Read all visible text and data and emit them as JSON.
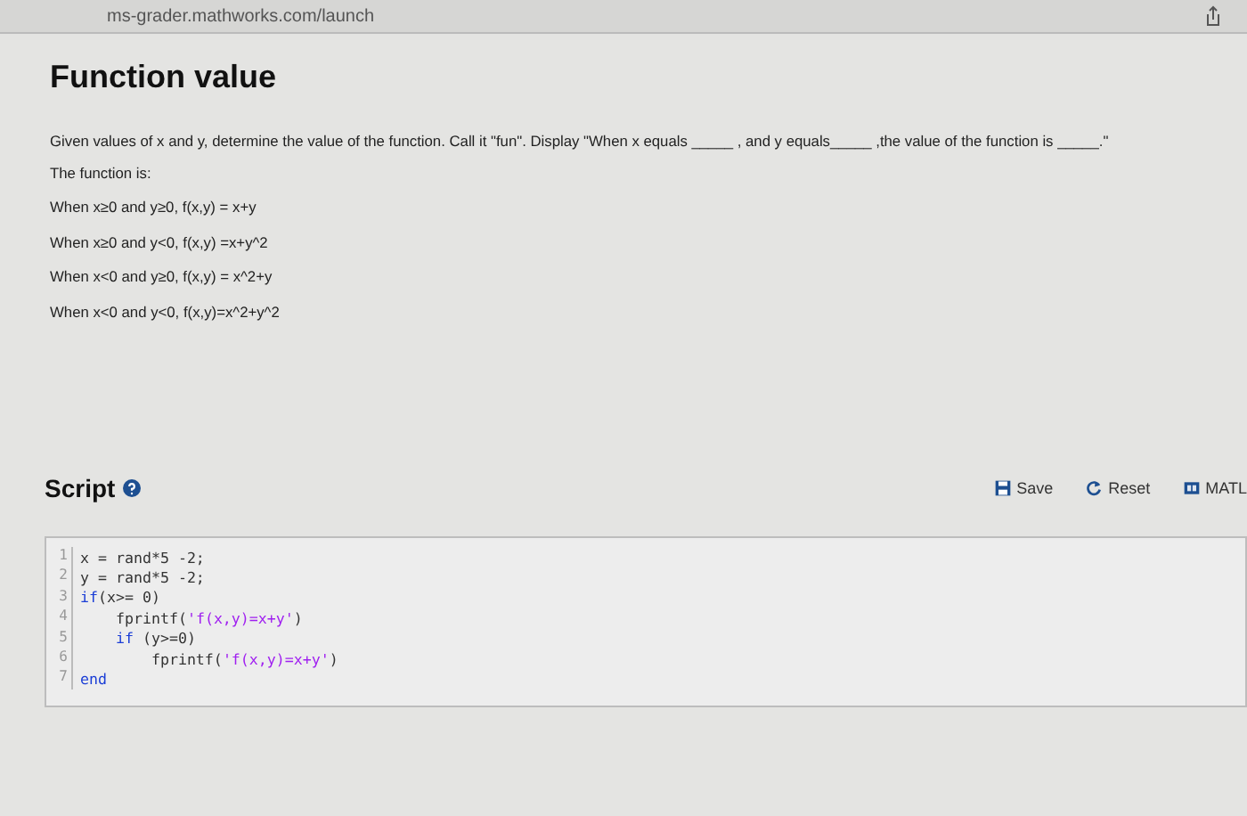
{
  "browser": {
    "url": "ms-grader.mathworks.com/launch"
  },
  "problem": {
    "title": "Function value",
    "description": "Given values of x and y, determine the value of the function.  Call it \"fun\".  Display \"When x equals _____ , and y equals_____ ,the value of the function is _____.\"",
    "intro": "The function is:",
    "cases": [
      "When  x≥0 and y≥0,  f(x,y) = x+y",
      "When  x≥0 and y<0, f(x,y) =x+y^2",
      "When  x<0 and y≥0,  f(x,y) = x^2+y",
      "When  x<0 and y<0,  f(x,y)=x^2+y^2"
    ]
  },
  "script": {
    "title": "Script",
    "buttons": [
      {
        "label": "Save",
        "kind": "save"
      },
      {
        "label": "Reset",
        "kind": "reset"
      },
      {
        "label": "MATL",
        "kind": "matlab"
      }
    ],
    "lines": [
      {
        "number": "1",
        "tokens": [
          {
            "text": "x = rand*5 -2;",
            "kind": "plain"
          }
        ]
      },
      {
        "number": "2",
        "tokens": [
          {
            "text": "y = rand*5 -2;",
            "kind": "plain"
          }
        ]
      },
      {
        "number": "3",
        "tokens": [
          {
            "text": "if",
            "kind": "keyword"
          },
          {
            "text": "(x>= 0)",
            "kind": "plain"
          }
        ]
      },
      {
        "number": "4",
        "tokens": [
          {
            "text": "    fprintf(",
            "kind": "plain"
          },
          {
            "text": "'f(x,y)=x+y'",
            "kind": "string"
          },
          {
            "text": ")",
            "kind": "plain"
          }
        ]
      },
      {
        "number": "5",
        "tokens": [
          {
            "text": "    if",
            "kind": "keyword"
          },
          {
            "text": " (y>=0)",
            "kind": "plain"
          }
        ]
      },
      {
        "number": "6",
        "tokens": [
          {
            "text": "        fprintf(",
            "kind": "plain"
          },
          {
            "text": "'f(x,y)=x+y'",
            "kind": "string"
          },
          {
            "text": ")",
            "kind": "plain"
          }
        ]
      },
      {
        "number": "7",
        "tokens": [
          {
            "text": "end",
            "kind": "keyword"
          }
        ]
      }
    ]
  }
}
